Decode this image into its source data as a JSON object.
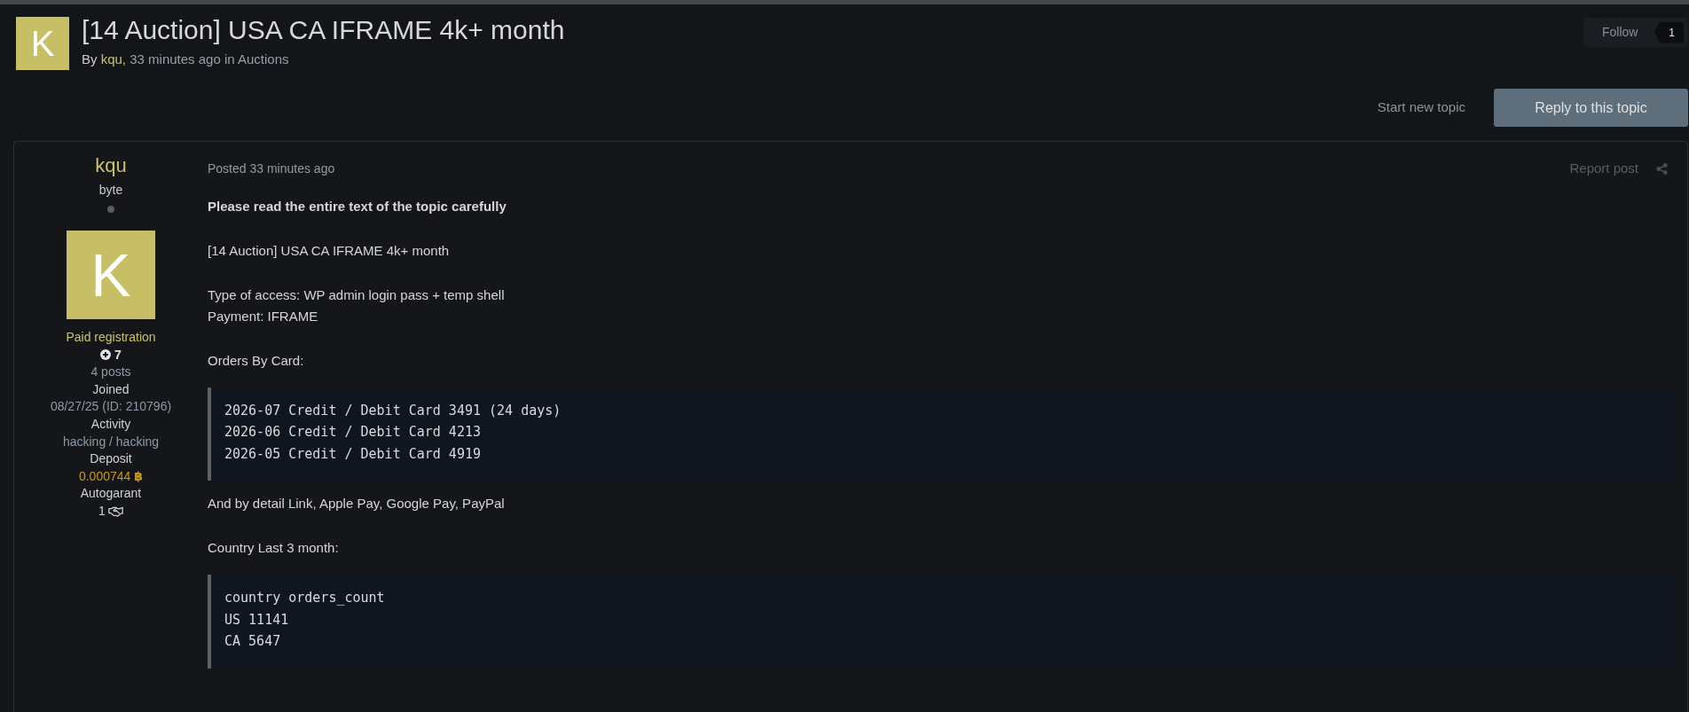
{
  "topic": {
    "avatar_letter": "K",
    "title": "[14 Auction] USA CA IFRAME 4k+ month",
    "byline": {
      "prefix": "By",
      "author": "kqu,",
      "middle": "33 minutes ago in",
      "forum": "Auctions"
    }
  },
  "follow": {
    "label": "Follow",
    "count": "1"
  },
  "actions": {
    "start_topic": "Start new topic",
    "reply": "Reply to this topic"
  },
  "post": {
    "author": {
      "name": "kqu",
      "rank": "byte",
      "online": false,
      "avatar_letter": "K",
      "group": "Paid registration",
      "reputation": "7",
      "posts": "4 posts",
      "fields": [
        {
          "kind": "text",
          "label": "Joined",
          "value": "08/27/25 (ID: 210796)"
        },
        {
          "kind": "text",
          "label": "Activity",
          "value": "hacking / hacking"
        },
        {
          "kind": "deposit",
          "label": "Deposit",
          "value": "0.000744",
          "symbol": "฿"
        },
        {
          "kind": "deals",
          "label": "Autogarant",
          "value": "1"
        }
      ]
    },
    "posted": "Posted 33 minutes ago",
    "report": "Report post",
    "body": [
      {
        "kind": "paragraph",
        "bold": true,
        "lines": [
          "Please read the entire text of the topic carefully"
        ]
      },
      {
        "kind": "paragraph",
        "bold": false,
        "lines": [
          "[14 Auction] USA CA IFRAME 4k+ month"
        ]
      },
      {
        "kind": "paragraph",
        "bold": false,
        "lines": [
          "Type of access: WP admin login pass + temp shell",
          "Payment: IFRAME"
        ]
      },
      {
        "kind": "paragraph",
        "bold": false,
        "lines": [
          "Orders By Card:"
        ]
      },
      {
        "kind": "code",
        "lines": [
          "2026-07 Credit / Debit Card 3491 (24 days)",
          "2026-06 Credit / Debit Card 4213",
          "2026-05 Credit / Debit Card 4919"
        ]
      },
      {
        "kind": "paragraph",
        "bold": false,
        "lines": [
          "And by detail Link, Apple Pay, Google Pay, PayPal"
        ]
      },
      {
        "kind": "paragraph",
        "bold": false,
        "lines": [
          "Country Last 3 month:"
        ]
      },
      {
        "kind": "code",
        "lines": [
          "country orders_count",
          "US 11141",
          "CA 5647"
        ]
      }
    ]
  }
}
